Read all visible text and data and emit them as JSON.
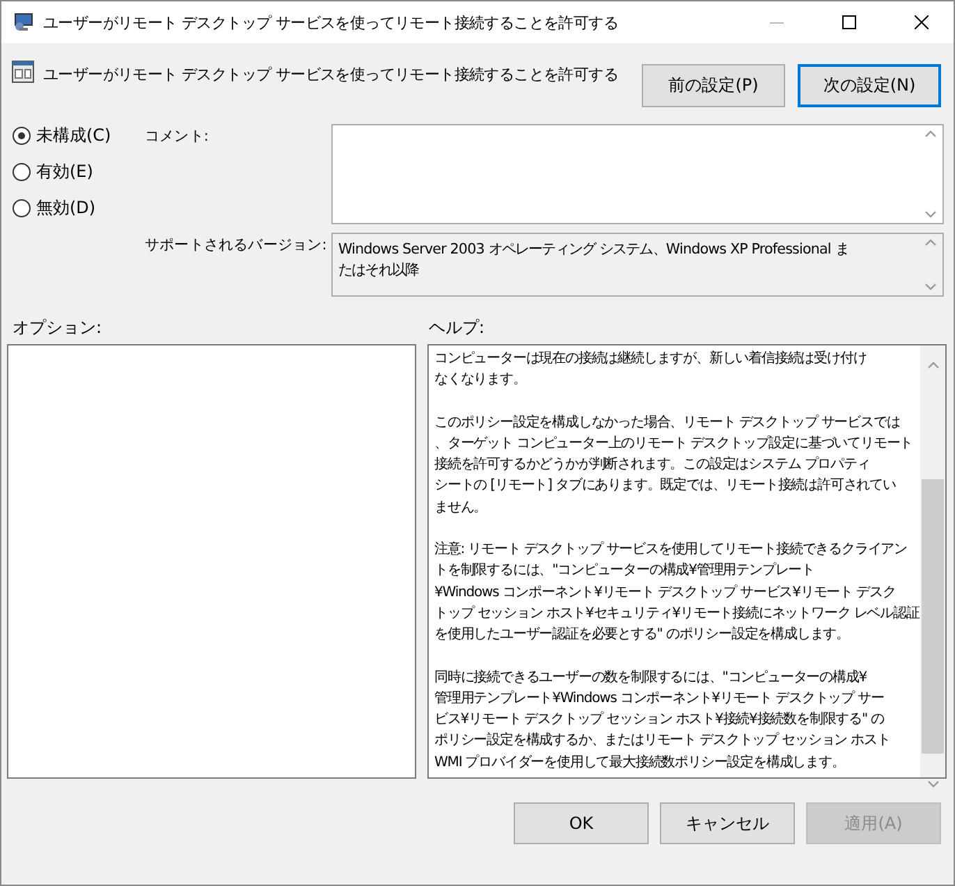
{
  "window": {
    "title": "ユーザーがリモート デスクトップ サービスを使ってリモート接続することを許可する"
  },
  "header": {
    "title": "ユーザーがリモート デスクトップ サービスを使ってリモート接続することを許可する"
  },
  "nav_buttons": [
    {
      "label": "前の設定(P)",
      "focused": false
    },
    {
      "label": "次の設定(N)",
      "focused": true
    }
  ],
  "options": [
    {
      "label": "未構成(C)",
      "selected": true
    },
    {
      "label": "有効(E)",
      "selected": false
    },
    {
      "label": "無効(D)",
      "selected": false
    }
  ],
  "comment": {
    "label": "コメント:"
  },
  "supported": {
    "label": "サポートされるバージョン:",
    "lines": [
      "Windows Server 2003 オペレーティング システム、Windows XP Professional ま",
      "たはそれ以降"
    ]
  },
  "options_label": "オプション:",
  "help_label": "ヘルプ:",
  "help": [
    {
      "lines": [
        "コンピューターは現在の接続は継続しますが、新しい着信接続は受け付け",
        "なくなります。"
      ]
    },
    {
      "lines": [
        "このポリシー設定を構成しなかった場合、リモート デスクトップ サービスでは",
        "、ターゲット コンピューター上のリモート デスクトップ設定に基づいてリモート",
        "接続を許可するかどうかが判断されます。この設定はシステム プロパティ",
        "シートの [リモート] タブにあります。既定では、リモート接続は許可されてい",
        "ません。"
      ]
    },
    {
      "lines": [
        "注意: リモート デスクトップ サービスを使用してリモート接続できるクライアン",
        "トを制限するには、\"コンピューターの構成¥管理用テンプレート",
        "¥Windows コンポーネント¥リモート デスクトップ サービス¥リモート デスク",
        "トップ セッション ホスト¥セキュリティ¥リモート接続にネットワーク レベル認証",
        "を使用したユーザー認証を必要とする\" のポリシー設定を構成します。"
      ]
    },
    {
      "lines": [
        "同時に接続できるユーザーの数を制限するには、\"コンピューターの構成¥",
        "管理用テンプレート¥Windows コンポーネント¥リモート デスクトップ サー",
        "ビス¥リモート デスクトップ セッション ホスト¥接続¥接続数を制限する\" の",
        "ポリシー設定を構成するか、またはリモート デスクトップ セッション ホスト",
        "WMI プロバイダーを使用して最大接続数ポリシー設定を構成します。"
      ]
    }
  ],
  "footer_buttons": [
    {
      "label": "OK",
      "disabled": false
    },
    {
      "label": "キャンセル",
      "disabled": false
    },
    {
      "label": "適用(A)",
      "disabled": true
    }
  ]
}
